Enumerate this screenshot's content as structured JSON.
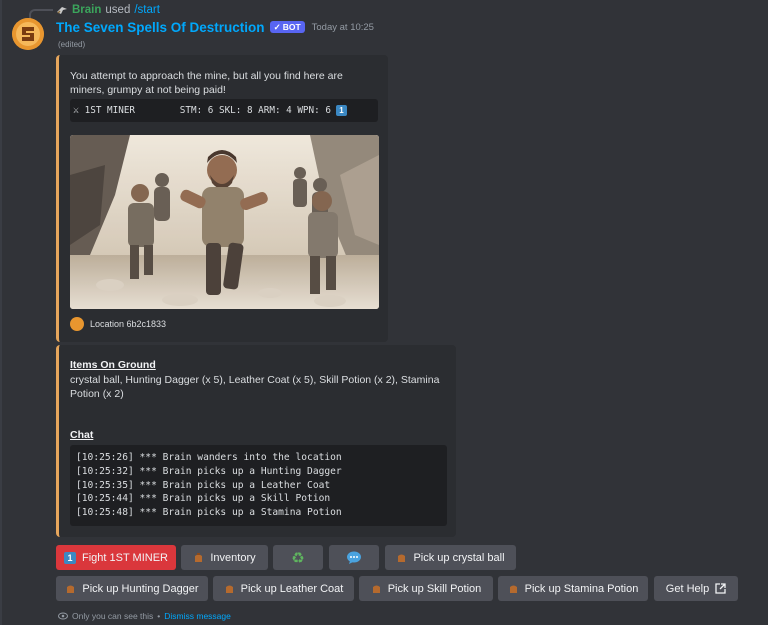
{
  "reply": {
    "user": "Brain",
    "used": "used",
    "command": "/start"
  },
  "message": {
    "bot_name": "The Seven Spells Of Destruction",
    "badge": "BOT",
    "timestamp": "Today at 10:25",
    "edited": "(edited)"
  },
  "embed1": {
    "description": "You attempt to approach the mine, but all you find here are miners, grumpy at not being paid!",
    "stats_line": "1ST MINER        STM: 6 SKL: 8 ARM: 4 WPN: 6",
    "stats_badge": "1",
    "footer": "Location 6b2c1833"
  },
  "embed2": {
    "items_title": "Items On Ground",
    "items": "crystal ball, Hunting Dagger (x 5), Leather Coat (x 5), Skill Potion (x 2), Stamina Potion (x 2)",
    "chat_title": "Chat",
    "chat_lines": [
      "[10:25:26] *** Brain wanders into the location",
      "[10:25:32] *** Brain picks up a Hunting Dagger",
      "[10:25:35] *** Brain picks up a Leather Coat",
      "[10:25:44] *** Brain picks up a Skill Potion",
      "[10:25:48] *** Brain picks up a Stamina Potion"
    ]
  },
  "buttons": {
    "fight_badge": "1",
    "fight": "Fight 1ST MINER",
    "inventory": "Inventory",
    "pickup_crystal": "Pick up crystal ball",
    "pickup_dagger": "Pick up Hunting Dagger",
    "pickup_coat": "Pick up Leather Coat",
    "pickup_skill": "Pick up Skill Potion",
    "pickup_stamina": "Pick up Stamina Potion",
    "help": "Get Help"
  },
  "ephemeral": {
    "notice": "Only you can see this",
    "separator": "•",
    "dismiss": "Dismiss message"
  },
  "colors": {
    "accent": "#e6a65c",
    "fight_button": "#da373c",
    "secondary_button": "#4e5058",
    "link": "#00a8fc"
  }
}
